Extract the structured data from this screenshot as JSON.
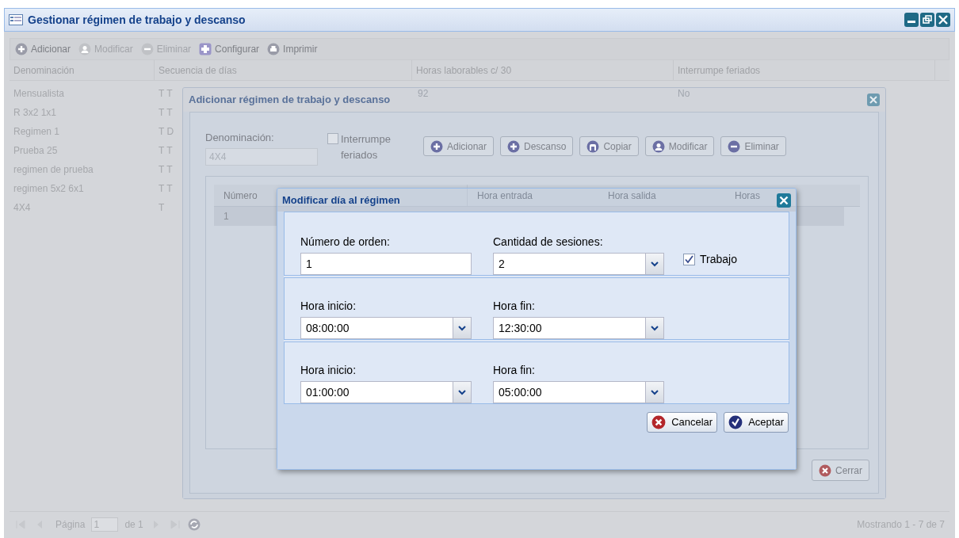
{
  "window": {
    "title": "Gestionar régimen de trabajo y descanso"
  },
  "toolbar": [
    {
      "label": "Adicionar",
      "kind": "add",
      "disabled": false
    },
    {
      "label": "Modificar",
      "kind": "edit",
      "disabled": true
    },
    {
      "label": "Eliminar",
      "kind": "delete",
      "disabled": true
    },
    {
      "label": "Configurar",
      "kind": "config",
      "disabled": false
    },
    {
      "label": "Imprimir",
      "kind": "print",
      "disabled": false
    }
  ],
  "grid": {
    "columns": [
      "Denominación",
      "Secuencia de días",
      "Horas laborables c/ 30",
      "Interrumpe feriados"
    ],
    "rows": [
      {
        "cells": [
          "Mensualista",
          "T T",
          "92",
          "No"
        ]
      },
      {
        "cells": [
          "R 3x2 1x1",
          "T T"
        ]
      },
      {
        "cells": [
          "Regimen 1",
          "T D"
        ]
      },
      {
        "cells": [
          "Prueba 25",
          "T T"
        ]
      },
      {
        "cells": [
          "regimen de prueba",
          "T T"
        ]
      },
      {
        "cells": [
          "regimen 5x2 6x1",
          "T T"
        ]
      },
      {
        "cells": [
          "4X4",
          "T"
        ]
      }
    ]
  },
  "paging": {
    "page_label": "Página",
    "page": "1",
    "of_label": "de 1",
    "summary": "Mostrando 1 - 7 de 7"
  },
  "dialog": {
    "title": "Adicionar régimen de trabajo y descanso",
    "name_label": "Denominación:",
    "name_value": "4X4",
    "holidays": {
      "label": "Interrumpe feriados",
      "checked": false
    },
    "buttons": [
      {
        "label": "Adicionar",
        "kind": "add"
      },
      {
        "label": "Descanso",
        "kind": "add"
      },
      {
        "label": "Copiar",
        "kind": "copy"
      },
      {
        "label": "Modificar",
        "kind": "edit"
      },
      {
        "label": "Eliminar",
        "kind": "delete"
      }
    ],
    "grid": {
      "columns": [
        "Número",
        "Hora entrada",
        "Hora salida",
        "Horas"
      ],
      "rows": [
        {
          "cells": [
            "1"
          ],
          "selected": true
        }
      ]
    },
    "close_button": "Cerrar"
  },
  "day_dialog": {
    "title": "Modificar día al régimen",
    "order_label": "Número de orden:",
    "order_value": "1",
    "sessions_label": "Cantidad de sesiones:",
    "sessions_value": "2",
    "work": {
      "label": "Trabajo",
      "checked": true
    },
    "sessions": [
      {
        "start_label": "Hora inicio:",
        "start": "08:00:00",
        "end_label": "Hora fin:",
        "end": "12:30:00"
      },
      {
        "start_label": "Hora inicio:",
        "start": "01:00:00",
        "end_label": "Hora fin:",
        "end": "05:00:00"
      }
    ],
    "buttons": [
      {
        "label": "Cancelar",
        "kind": "cancel"
      },
      {
        "label": "Aceptar",
        "kind": "accept"
      }
    ]
  }
}
